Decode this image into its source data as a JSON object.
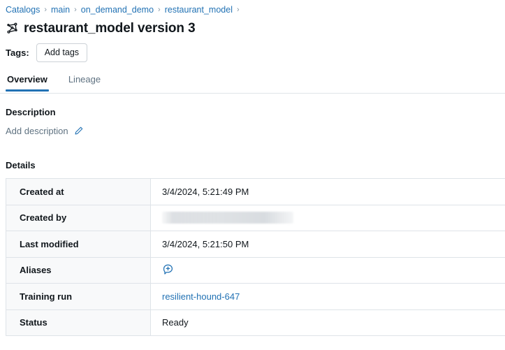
{
  "breadcrumb": {
    "separator": "›",
    "items": [
      {
        "label": "Catalogs"
      },
      {
        "label": "main"
      },
      {
        "label": "on_demand_demo"
      },
      {
        "label": "restaurant_model"
      }
    ],
    "trailing_separator": "›"
  },
  "header": {
    "icon": "model-graph-icon",
    "title": "restaurant_model version 3"
  },
  "tags": {
    "label": "Tags:",
    "add_button_label": "Add tags"
  },
  "tabs": [
    {
      "label": "Overview",
      "active": true
    },
    {
      "label": "Lineage",
      "active": false
    }
  ],
  "description": {
    "heading": "Description",
    "placeholder": "Add description",
    "edit_icon": "pencil-edit-icon"
  },
  "details": {
    "heading": "Details",
    "rows": [
      {
        "key": "Created at",
        "value": "3/4/2024, 5:21:49 PM",
        "type": "text"
      },
      {
        "key": "Created by",
        "value": "",
        "type": "redacted"
      },
      {
        "key": "Last modified",
        "value": "3/4/2024, 5:21:50 PM",
        "type": "text"
      },
      {
        "key": "Aliases",
        "value": "",
        "type": "icon",
        "icon": "add-alias-icon"
      },
      {
        "key": "Training run",
        "value": "resilient-hound-647",
        "type": "link"
      },
      {
        "key": "Status",
        "value": "Ready",
        "type": "text"
      }
    ]
  },
  "colors": {
    "link": "#2272b4",
    "accent": "#2272b4",
    "text": "#11171c",
    "muted": "#5f7281",
    "border": "#dee3e8",
    "key_cell_bg": "#f8f9fa"
  }
}
